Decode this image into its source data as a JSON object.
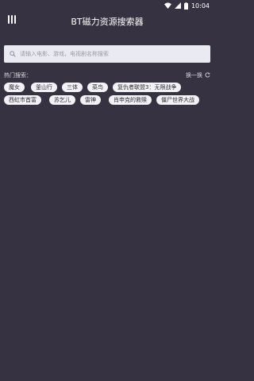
{
  "status_bar": {
    "time": "10:04",
    "icons": [
      "wifi-icon",
      "signal-icon",
      "battery-icon"
    ]
  },
  "app_bar": {
    "title": "BT磁力资源搜索器",
    "menu_icon": "vertical-bars-icon"
  },
  "search": {
    "placeholder": "请输入电影、游戏，电视剧名称搜索",
    "icon": "search-icon"
  },
  "hot": {
    "label": "热门搜索：",
    "refresh_label": "换一换",
    "refresh_icon": "refresh-icon",
    "tags": [
      "魔女",
      "釜山行",
      "三体",
      "菜鸟",
      "复仇者联盟3：无限战争",
      "西虹市首富",
      "苏乞儿",
      "雷神",
      "肖申克的救赎",
      "僵尸世界大战"
    ]
  },
  "colors": {
    "background": "#373241",
    "tag_background": "#f3f2f7",
    "search_background": "#e9eaf2"
  }
}
